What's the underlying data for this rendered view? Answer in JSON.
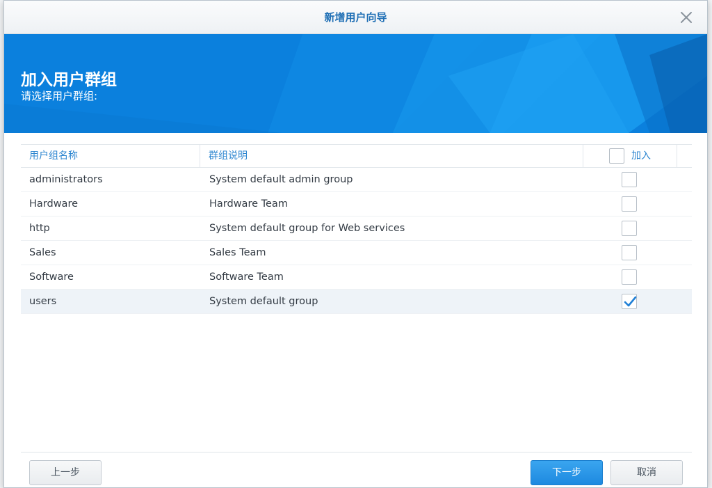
{
  "dialog": {
    "title": "新增用户向导",
    "close_icon": "close-icon"
  },
  "banner": {
    "heading": "加入用户群组",
    "subheading": "请选择用户群组:"
  },
  "grid": {
    "columns": {
      "name": "用户组名称",
      "description": "群组说明",
      "join": "加入"
    },
    "rows": [
      {
        "name": "administrators",
        "description": "System default admin group",
        "checked": false
      },
      {
        "name": "Hardware",
        "description": "Hardware Team",
        "checked": false
      },
      {
        "name": "http",
        "description": "System default group for Web services",
        "checked": false
      },
      {
        "name": "Sales",
        "description": "Sales Team",
        "checked": false
      },
      {
        "name": "Software",
        "description": "Software Team",
        "checked": false
      },
      {
        "name": "users",
        "description": "System default group",
        "checked": true
      }
    ]
  },
  "buttons": {
    "prev": "上一步",
    "next": "下一步",
    "cancel": "取消"
  },
  "colors": {
    "accent": "#1f6fb5",
    "banner": "#0a7fdc",
    "primary_button": "#2a96e8",
    "check": "#1f7fd6"
  }
}
